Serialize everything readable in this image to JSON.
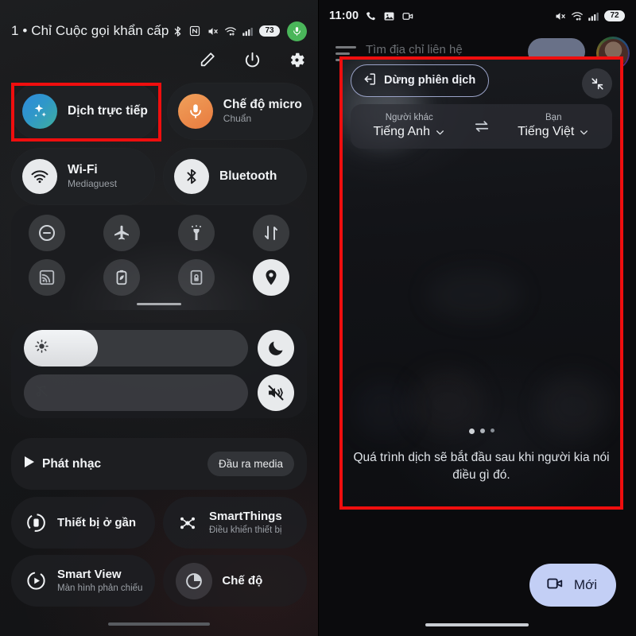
{
  "left_panel": {
    "status_bar": {
      "carrier_text": "1 • Chỉ Cuộc gọi khẩn cấp",
      "icons": [
        "bluetooth-icon",
        "nfc-icon",
        "mute-icon",
        "wifi-calling-icon",
        "signal-bars-icon"
      ],
      "battery_level": "73",
      "mic_badge": "mic-icon"
    },
    "actions": [
      {
        "name": "edit-button",
        "icon": "pencil-icon"
      },
      {
        "name": "power-button",
        "icon": "power-icon"
      },
      {
        "name": "settings-button",
        "icon": "gear-icon"
      }
    ],
    "tiles": [
      {
        "title": "Dịch trực tiếp",
        "sub": "",
        "icon": "sparkle-translate-icon",
        "highlighted": true
      },
      {
        "title": "Chế độ micro",
        "sub": "Chuẩn",
        "icon": "mic-icon",
        "highlighted": false
      },
      {
        "title": "Wi-Fi",
        "sub": "Mediaguest",
        "icon": "wifi-icon",
        "highlighted": false
      },
      {
        "title": "Bluetooth",
        "sub": "",
        "icon": "bluetooth-icon",
        "highlighted": false
      }
    ],
    "grid_icons": [
      {
        "name": "do-not-disturb-icon",
        "active": false
      },
      {
        "name": "airplane-mode-icon",
        "active": false
      },
      {
        "name": "flashlight-icon",
        "active": false
      },
      {
        "name": "mobile-data-icon",
        "active": false
      },
      {
        "name": "screen-cast-icon",
        "active": false
      },
      {
        "name": "battery-saver-icon",
        "active": false
      },
      {
        "name": "auto-rotate-lock-icon",
        "active": false
      },
      {
        "name": "location-icon",
        "active": true
      }
    ],
    "sliders": [
      {
        "name": "brightness-slider",
        "icon": "brightness-icon",
        "fill_percent": 33
      },
      {
        "name": "volume-slider",
        "icon": "music-off-icon",
        "fill_percent": 0
      }
    ],
    "side_buttons": [
      {
        "name": "night-mode-button",
        "icon": "moon-icon"
      },
      {
        "name": "sound-vibrate-button",
        "icon": "volume-off-vibrate-icon"
      }
    ],
    "media": {
      "label": "Phát nhạc",
      "icon": "play-icon",
      "output_label": "Đầu ra media"
    },
    "pair_tiles": [
      {
        "title": "Thiết bị ở gần",
        "sub": "",
        "icon": "nearby-devices-icon"
      },
      {
        "title": "SmartThings",
        "sub": "Điều khiển thiết bị",
        "icon": "smartthings-icon"
      },
      {
        "title": "Smart View",
        "sub": "Màn hình phản chiếu",
        "icon": "smart-view-icon"
      },
      {
        "title": "Chế độ",
        "sub": "",
        "icon": "modes-routines-icon"
      }
    ]
  },
  "right_panel": {
    "status_bar": {
      "time": "11:00",
      "left_icons": [
        "phone-icon",
        "photo-icon",
        "video-camera-icon"
      ],
      "right_icons": [
        "mute-icon",
        "wifi-calling-icon",
        "signal-bars-icon"
      ],
      "battery_level": "72"
    },
    "app_chrome": {
      "menu_icon": "hamburger-icon",
      "search_text": "Tìm địa chỉ liên hệ",
      "avatar": "avatar"
    },
    "translate_sheet": {
      "stop_button_label": "Dừng phiên dịch",
      "stop_button_icon": "exit-icon",
      "collapse_icon": "collapse-arrows-icon",
      "languages": {
        "other_label": "Người khác",
        "other_value": "Tiếng Anh",
        "you_label": "Bạn",
        "you_value": "Tiếng Việt",
        "swap_icon": "swap-arrows-icon",
        "chevron_icon": "chevron-down-icon"
      },
      "status_dots": 3,
      "hint_text": "Quá trình dịch sẽ bắt đầu sau khi người kia nói điều gì đó."
    },
    "new_button": {
      "label": "Mới",
      "icon": "video-camera-icon"
    }
  },
  "annotations": {
    "accent_color": "#ef0e0e",
    "boxes": [
      "live-translate-tile",
      "translate-session-sheet"
    ]
  }
}
